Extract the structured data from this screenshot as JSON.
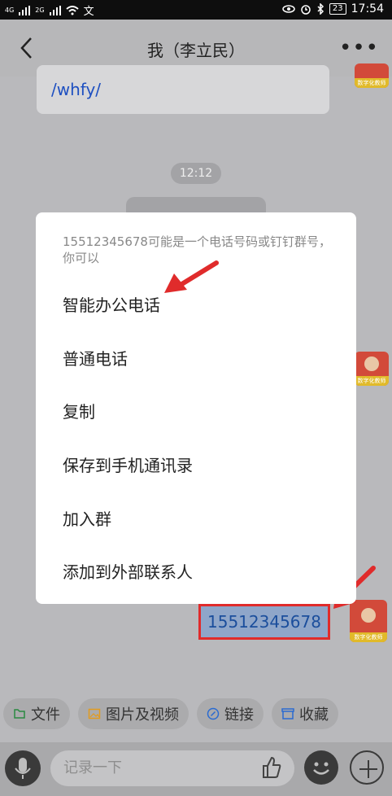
{
  "status_bar": {
    "sig1": "4G",
    "sig2": "2G",
    "battery": "23",
    "time": "17:54"
  },
  "header": {
    "title": "我（李立民）",
    "more": "•••"
  },
  "chat": {
    "link_text": "/whfy/",
    "timestamp": "12:12",
    "number_message": "15512345678",
    "avatar_tag": "数字化教师"
  },
  "popup": {
    "hint": "15512345678可能是一个电话号码或钉钉群号，你可以",
    "items": [
      "智能办公电话",
      "普通电话",
      "复制",
      "保存到手机通讯录",
      "加入群",
      "添加到外部联系人"
    ]
  },
  "quick_actions": [
    {
      "label": "文件",
      "icon": "file-icon",
      "color": "#2a8a42"
    },
    {
      "label": "图片及视频",
      "icon": "image-icon",
      "color": "#e29b1f"
    },
    {
      "label": "链接",
      "icon": "link-icon",
      "color": "#2a6bd1"
    },
    {
      "label": "收藏",
      "icon": "box-icon",
      "color": "#2a6bd1"
    }
  ],
  "input": {
    "placeholder": "记录一下"
  },
  "colors": {
    "highlight_red": "#e02b2b",
    "link_blue": "#1d4fc1"
  }
}
